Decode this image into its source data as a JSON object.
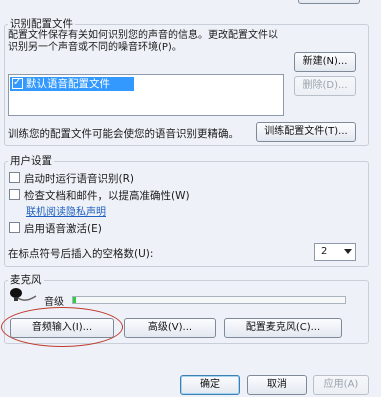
{
  "profiles": {
    "group_title": "识别配置文件",
    "description": "配置文件保存有关如何识别您的声音的信息。更改配置文件以识别另一个声音或不同的噪音环境(P)。",
    "list_items": [
      {
        "label": "默认语音配置文件",
        "checked": true,
        "selected": true
      }
    ],
    "new_button": "新建(N)...",
    "delete_button": "删除(D)...",
    "train_text": "训练您的配置文件可能会使您的语音识别更精确。",
    "train_button": "训练配置文件(T)..."
  },
  "user_settings": {
    "group_title": "用户设置",
    "run_at_startup": "启动时运行语音识别(R)",
    "review_docs": "检查文档和邮件，以提高准确性(W)",
    "privacy_link": "联机阅读隐私声明",
    "voice_activation": "启用语音激活(E)",
    "spaces_label": "在标点符号后插入的空格数(U):",
    "spaces_value": "2"
  },
  "microphone": {
    "group_title": "麦克风",
    "level_label": "音级",
    "level": 0.01,
    "audio_input_button": "音频输入(I)...",
    "advanced_button": "高级(V)...",
    "configure_button": "配置麦克风(C)..."
  },
  "footer": {
    "ok": "确定",
    "cancel": "取消",
    "apply": "应用(A)"
  }
}
